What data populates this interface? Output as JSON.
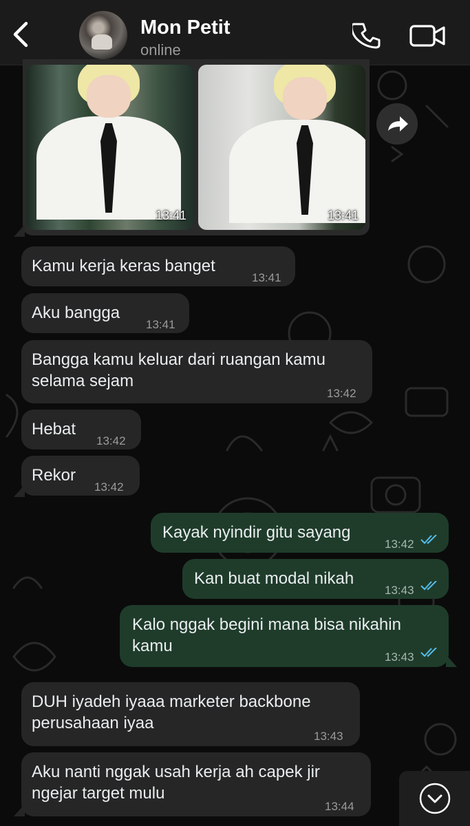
{
  "header": {
    "contact_name": "Mon Petit",
    "status": "online"
  },
  "photos": [
    {
      "time": "13:41"
    },
    {
      "time": "13:41"
    }
  ],
  "messages": [
    {
      "dir": "in",
      "text": "Kamu kerja keras banget",
      "time": "13:41"
    },
    {
      "dir": "in",
      "text": "Aku bangga",
      "time": "13:41"
    },
    {
      "dir": "in",
      "text": "Bangga kamu keluar dari ruangan kamu\nselama sejam",
      "time": "13:42"
    },
    {
      "dir": "in",
      "text": "Hebat",
      "time": "13:42"
    },
    {
      "dir": "in",
      "text": "Rekor",
      "time": "13:42"
    },
    {
      "dir": "out",
      "text": "Kayak nyindir gitu sayang",
      "time": "13:42"
    },
    {
      "dir": "out",
      "text": "Kan buat modal nikah",
      "time": "13:43"
    },
    {
      "dir": "out",
      "text": "Kalo nggak begini mana bisa nikahin\nkamu",
      "time": "13:43"
    },
    {
      "dir": "in",
      "text": "DUH iyadeh iyaaa marketer backbone\nperusahaan iyaa",
      "time": "13:43"
    },
    {
      "dir": "in",
      "text": "Aku nanti nggak usah kerja ah capek jir\nngejar target mulu",
      "time": "13:44"
    }
  ],
  "colors": {
    "incoming_bubble": "#262626",
    "outgoing_bubble": "#1f3c2b",
    "read_ticks": "#53bdeb"
  },
  "icons": {
    "back": "chevron-left-icon",
    "call": "phone-icon",
    "video": "video-camera-icon",
    "forward": "forward-arrow-icon",
    "scroll": "chevron-down-circle-icon"
  }
}
